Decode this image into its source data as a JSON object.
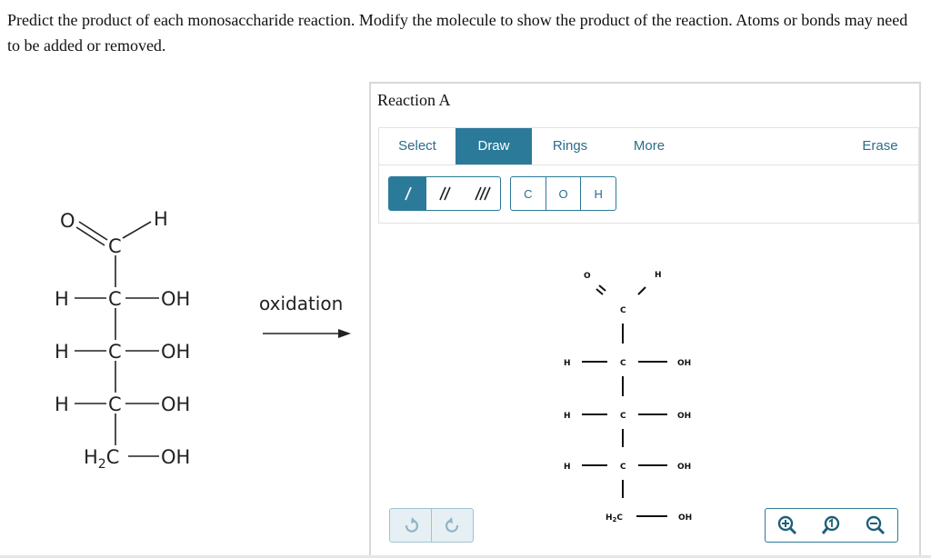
{
  "question": {
    "text": "Predict the product of each monosaccharide reaction. Modify the molecule to show the product of the reaction. Atoms or bonds may need to be added or removed."
  },
  "reactant": {
    "o": "O",
    "c1": "C",
    "h1": "H",
    "rows": [
      {
        "h": "H",
        "c": "C",
        "oh": "OH"
      },
      {
        "h": "H",
        "c": "C",
        "oh": "OH"
      },
      {
        "h": "H",
        "c": "C",
        "oh": "OH"
      }
    ],
    "h2c_h": "H",
    "h2c_sub": "2",
    "h2c_c": "C",
    "h2c_oh": "OH"
  },
  "reaction_label": "oxidation",
  "panel": {
    "title": "Reaction A",
    "tabs": {
      "select": "Select",
      "draw": "Draw",
      "rings": "Rings",
      "more": "More",
      "erase": "Erase"
    },
    "active_tab": "Draw",
    "atoms": [
      "C",
      "O",
      "H"
    ],
    "canvas": {
      "o": "O",
      "c1": "C",
      "h1": "H",
      "rows": [
        {
          "h": "H",
          "c": "C",
          "oh": "OH"
        },
        {
          "h": "H",
          "c": "C",
          "oh": "OH"
        },
        {
          "h": "H",
          "c": "C",
          "oh": "OH"
        }
      ],
      "h2c_h": "H",
      "h2c_sub": "2",
      "h2c_c": "C",
      "h2c_oh": "OH"
    }
  },
  "colors": {
    "accent": "#2b7a99",
    "border": "#d8d8d8"
  }
}
